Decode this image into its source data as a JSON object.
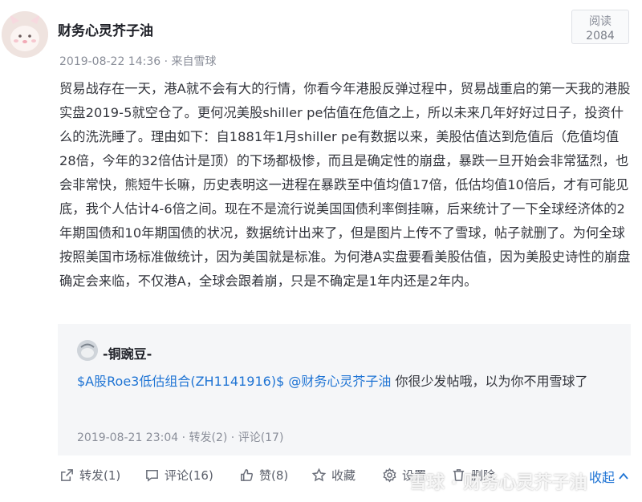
{
  "post": {
    "author": "财务心灵芥子油",
    "meta": "2019-08-22 14:36 · 来自雪球",
    "read_label": "阅读",
    "read_count": "2084",
    "body": "贸易战存在一天，港A就不会有大的行情，你看今年港股反弹过程中，贸易战重启的第一天我的港股实盘2019-5就空仓了。更何况美股shiller pe估值在危值之上，所以未来几年好好过日子，投资什么的洗洗睡了。理由如下：自1881年1月shiller pe有数据以来，美股估值达到危值后（危值均值28倍，今年的32倍估计是顶）的下场都极惨，而且是确定性的崩盘，暴跌一旦开始会非常猛烈，也会非常快，熊短牛长嘛，历史表明这一进程在暴跌至中值均值17倍，低估均值10倍后，才有可能见底，我个人估计4-6倍之间。现在不是流行说美国国债利率倒挂嘛，后来统计了一下全球经济体的2年期国债和10年期国债的状况，数据统计出来了，但是图片上传不了雪球，帖子就删了。为何全球按照美国市场标准做统计，因为美国就是标准。为何港A实盘要看美股估值，因为美股史诗性的崩盘确定会来临，不仅港A，全球会跟着崩，只是不确定是1年内还是2年内。"
  },
  "quote": {
    "author": "-铜豌豆-",
    "link1": "$A股Roe3低估组合(ZH1141916)$",
    "link2": "@财务心灵芥子油",
    "text": " 你很少发帖哦，以为你不用雪球了",
    "meta": "2019-08-21 23:04 · 转发(2) · 评论(17)"
  },
  "actions": {
    "repost": "转发(1)",
    "comment": "评论(16)",
    "like": "赞(8)",
    "favorite": "收藏",
    "settings": "设置",
    "delete": "删除",
    "collapse": "收起"
  },
  "watermark": "雪球 · 财务心灵芥子油",
  "icons": [
    "repost-icon",
    "comment-icon",
    "like-icon",
    "favorite-icon",
    "settings-icon",
    "delete-icon",
    "chevron-up-icon"
  ],
  "colors": {
    "link": "#1f74d4",
    "quote_bg": "#f5f6f8",
    "muted": "#8a8e99"
  }
}
